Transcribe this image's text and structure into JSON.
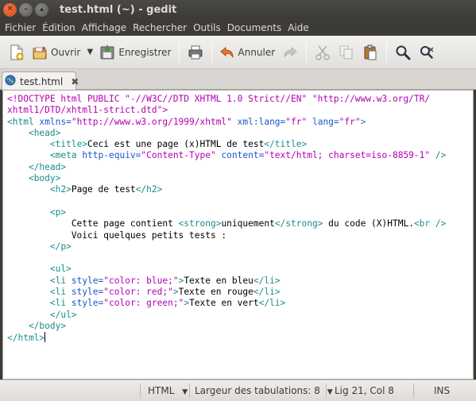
{
  "window": {
    "title": "test.html (~) - gedit"
  },
  "menu": [
    "Fichier",
    "Édition",
    "Affichage",
    "Rechercher",
    "Outils",
    "Documents",
    "Aide"
  ],
  "toolbar": {
    "open_label": "Ouvrir",
    "save_label": "Enregistrer",
    "undo_label": "Annuler"
  },
  "tab": {
    "label": "test.html"
  },
  "statusbar": {
    "language": "HTML",
    "tab_width": "Largeur des tabulations:  8",
    "position": "Lig 21, Col 8",
    "mode": "INS"
  },
  "colors": {
    "magenta": "#b200b2",
    "blue": "#1a58c9",
    "teal": "#1a8b8b"
  },
  "code": [
    [
      [
        "m",
        "<!DOCTYPE html PUBLIC \"-//W3C//DTD XHTML 1.0 Strict//EN\" \"http://www.w3.org/TR/"
      ]
    ],
    [
      [
        "m",
        "xhtml1/DTD/xhtml1-strict.dtd\">"
      ]
    ],
    [
      [
        "t",
        "<html "
      ],
      [
        "b",
        "xmlns="
      ],
      [
        "m",
        "\"http://www.w3.org/1999/xhtml\""
      ],
      [
        "b",
        " xml:lang="
      ],
      [
        "m",
        "\"fr\""
      ],
      [
        "b",
        " lang="
      ],
      [
        "m",
        "\"fr\""
      ],
      [
        "t",
        ">"
      ]
    ],
    [
      [
        "k",
        "    "
      ],
      [
        "t",
        "<head>"
      ]
    ],
    [
      [
        "k",
        "        "
      ],
      [
        "t",
        "<title>"
      ],
      [
        "k",
        "Ceci est une page (x)HTML de test"
      ],
      [
        "t",
        "</title>"
      ]
    ],
    [
      [
        "k",
        "        "
      ],
      [
        "t",
        "<meta "
      ],
      [
        "b",
        "http-equiv="
      ],
      [
        "m",
        "\"Content-Type\""
      ],
      [
        "b",
        " content="
      ],
      [
        "m",
        "\"text/html; charset=iso-8859-1\""
      ],
      [
        "t",
        " />"
      ]
    ],
    [
      [
        "k",
        "    "
      ],
      [
        "t",
        "</head>"
      ]
    ],
    [
      [
        "k",
        "    "
      ],
      [
        "t",
        "<body>"
      ]
    ],
    [
      [
        "k",
        "        "
      ],
      [
        "t",
        "<h2>"
      ],
      [
        "k",
        "Page de test"
      ],
      [
        "t",
        "</h2>"
      ]
    ],
    [
      [
        "k",
        ""
      ]
    ],
    [
      [
        "k",
        "        "
      ],
      [
        "t",
        "<p>"
      ]
    ],
    [
      [
        "k",
        "            Cette page contient "
      ],
      [
        "t",
        "<strong>"
      ],
      [
        "k",
        "uniquement"
      ],
      [
        "t",
        "</strong>"
      ],
      [
        "k",
        " du code (X)HTML."
      ],
      [
        "t",
        "<br />"
      ]
    ],
    [
      [
        "k",
        "            Voici quelques petits tests :"
      ]
    ],
    [
      [
        "k",
        "        "
      ],
      [
        "t",
        "</p>"
      ]
    ],
    [
      [
        "k",
        ""
      ]
    ],
    [
      [
        "k",
        "        "
      ],
      [
        "t",
        "<ul>"
      ]
    ],
    [
      [
        "k",
        "        "
      ],
      [
        "t",
        "<li "
      ],
      [
        "b",
        "style="
      ],
      [
        "m",
        "\"color: blue;\""
      ],
      [
        "t",
        ">"
      ],
      [
        "k",
        "Texte en bleu"
      ],
      [
        "t",
        "</li>"
      ]
    ],
    [
      [
        "k",
        "        "
      ],
      [
        "t",
        "<li "
      ],
      [
        "b",
        "style="
      ],
      [
        "m",
        "\"color: red;\""
      ],
      [
        "t",
        ">"
      ],
      [
        "k",
        "Texte en rouge"
      ],
      [
        "t",
        "</li>"
      ]
    ],
    [
      [
        "k",
        "        "
      ],
      [
        "t",
        "<li "
      ],
      [
        "b",
        "style="
      ],
      [
        "m",
        "\"color: green;\""
      ],
      [
        "t",
        ">"
      ],
      [
        "k",
        "Texte en vert"
      ],
      [
        "t",
        "</li>"
      ]
    ],
    [
      [
        "k",
        "        "
      ],
      [
        "t",
        "</ul>"
      ]
    ],
    [
      [
        "k",
        "    "
      ],
      [
        "t",
        "</body>"
      ]
    ],
    [
      [
        "t",
        "</html>"
      ]
    ]
  ]
}
